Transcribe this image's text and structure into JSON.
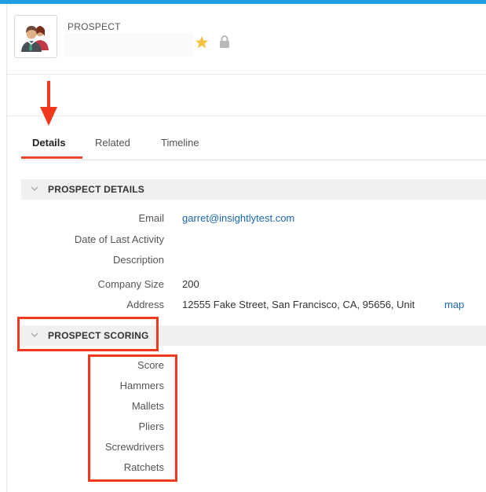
{
  "header": {
    "record_type": "PROSPECT",
    "record_name": ""
  },
  "tabs": [
    {
      "label": "Details",
      "active": true
    },
    {
      "label": "Related",
      "active": false
    },
    {
      "label": "Timeline",
      "active": false
    }
  ],
  "prospect_details": {
    "title": "PROSPECT DETAILS",
    "fields": [
      {
        "label": "Email",
        "value": "garret@insightlytest.com"
      },
      {
        "label": "Date of Last Activity",
        "value": ""
      },
      {
        "label": "Description",
        "value": ""
      },
      {
        "label": "Company Size",
        "value": "200"
      },
      {
        "label": "Address",
        "value": "12555 Fake Street, San Francisco, CA, 95656, Unit",
        "link": "map"
      }
    ]
  },
  "prospect_scoring": {
    "title": "PROSPECT SCORING",
    "fields": [
      {
        "label": "Score"
      },
      {
        "label": "Hammers"
      },
      {
        "label": "Mallets"
      },
      {
        "label": "Pliers"
      },
      {
        "label": "Screwdrivers"
      },
      {
        "label": "Ratchets"
      }
    ]
  },
  "icons": {
    "avatar": "contact-avatar-icon",
    "star": "star-icon",
    "lock": "lock-icon",
    "chevron": "chevron-down-icon"
  },
  "colors": {
    "accent_bar": "#1e9ee0",
    "annotation_red": "#f0391c",
    "link_blue": "#1a66b5",
    "star_gold": "#f2c240"
  }
}
